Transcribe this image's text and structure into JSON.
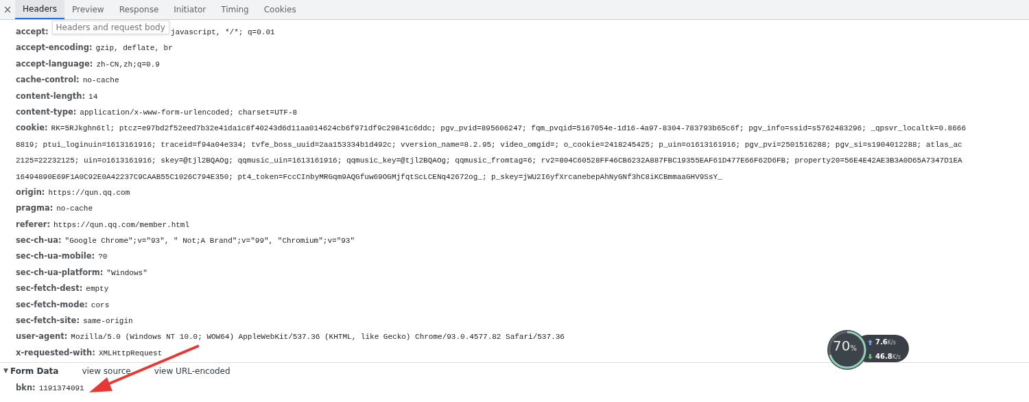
{
  "close_icon": "×",
  "tabs": [
    {
      "label": "Headers",
      "selected": true
    },
    {
      "label": "Preview",
      "selected": false
    },
    {
      "label": "Response",
      "selected": false
    },
    {
      "label": "Initiator",
      "selected": false
    },
    {
      "label": "Timing",
      "selected": false
    },
    {
      "label": "Cookies",
      "selected": false
    }
  ],
  "tooltip": "Headers and request body",
  "headers": [
    {
      "key": "accept:",
      "lines": [
        "javascript, */*; q=0.01"
      ]
    },
    {
      "key": "accept-encoding:",
      "lines": [
        "gzip, deflate, br"
      ]
    },
    {
      "key": "accept-language:",
      "lines": [
        "zh-CN,zh;q=0.9"
      ]
    },
    {
      "key": "cache-control:",
      "lines": [
        "no-cache"
      ]
    },
    {
      "key": "content-length:",
      "lines": [
        "14"
      ]
    },
    {
      "key": "content-type:",
      "lines": [
        "application/x-www-form-urlencoded; charset=UTF-8"
      ]
    },
    {
      "key": "cookie:",
      "lines": [
        "RK=5RJkghn6tl; ptcz=e97bd2f52eed7b32e41da1c8f40243d6d11aa014624cb6f971df9c29841c6ddc; pgv_pvid=895606247; fqm_pvqid=5167054e-1d16-4a97-8304-783793b65c6f; pgv_info=ssid=s5762483296; _qpsvr_localtk=0.8666",
        "8819; ptui_loginuin=1613161916; traceid=f94a04e334; tvfe_boss_uuid=2aa153334b1d492c; vversion_name=8.2.95; video_omgid=; o_cookie=2418245425; p_uin=o1613161916; pgv_pvi=2501516288; pgv_si=s1904012288; atlas_ac",
        "2125=22232125; uin=o1613161916; skey=@tjl2BQAOg; qqmusic_uin=1613161916; qqmusic_key=@tjl2BQAOg; qqmusic_fromtag=6; rv2=804C60528FF46CB6232A887FBC19355EAF61D477E66F62D6FB; property20=56E4E42AE3B3A0D65A7347D1EA",
        "16494890E69F1A0C92E0A42237C9CAAB55C1026C794E350; pt4_token=FccCInbyMRGqm9AQGfuw69OGMjfqtScLCENq42672og_; p_skey=jWU2I6yfXrcanebepAhNyGNf3hC8iKCBmmaaGHV9SsY_"
      ]
    },
    {
      "key": "origin:",
      "lines": [
        "https://qun.qq.com"
      ]
    },
    {
      "key": "pragma:",
      "lines": [
        "no-cache"
      ]
    },
    {
      "key": "referer:",
      "lines": [
        "https://qun.qq.com/member.html"
      ]
    },
    {
      "key": "sec-ch-ua:",
      "lines": [
        "\"Google Chrome\";v=\"93\", \" Not;A Brand\";v=\"99\", \"Chromium\";v=\"93\""
      ]
    },
    {
      "key": "sec-ch-ua-mobile:",
      "lines": [
        "?0"
      ]
    },
    {
      "key": "sec-ch-ua-platform:",
      "lines": [
        "\"Windows\""
      ]
    },
    {
      "key": "sec-fetch-dest:",
      "lines": [
        "empty"
      ]
    },
    {
      "key": "sec-fetch-mode:",
      "lines": [
        "cors"
      ]
    },
    {
      "key": "sec-fetch-site:",
      "lines": [
        "same-origin"
      ]
    },
    {
      "key": "user-agent:",
      "lines": [
        "Mozilla/5.0 (Windows NT 10.0; WOW64) AppleWebKit/537.36 (KHTML, like Gecko) Chrome/93.0.4577.82 Safari/537.36"
      ]
    },
    {
      "key": "x-requested-with:",
      "lines": [
        "XMLHttpRequest"
      ]
    }
  ],
  "form_data": {
    "expanded": true,
    "caret": "▼",
    "title": "Form Data",
    "links": [
      "view source",
      "view URL-encoded"
    ],
    "fields": [
      {
        "key": "bkn:",
        "value": "1191374091"
      }
    ]
  },
  "speed_widget": {
    "percent": "70",
    "percent_unit": "%",
    "upload": "7.6",
    "upload_unit": "K/s",
    "download": "46.8",
    "download_unit": "K/s"
  }
}
